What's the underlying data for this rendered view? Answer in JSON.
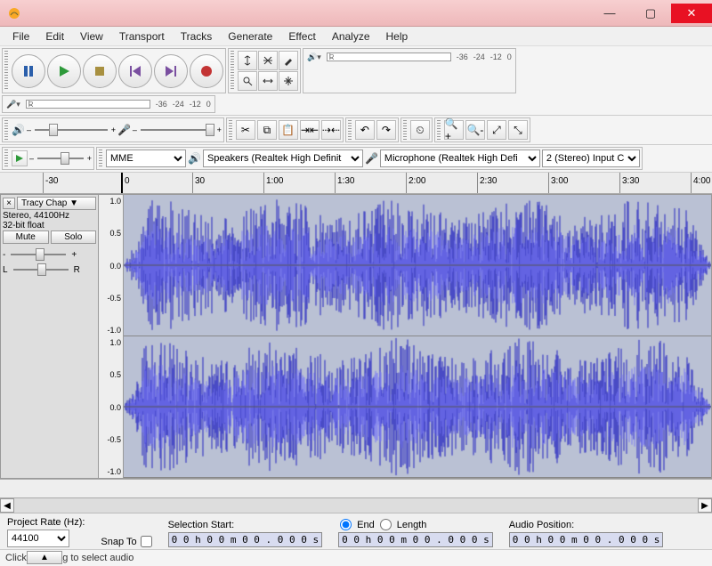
{
  "window": {
    "title": ""
  },
  "menu": [
    "File",
    "Edit",
    "View",
    "Transport",
    "Tracks",
    "Generate",
    "Effect",
    "Analyze",
    "Help"
  ],
  "meter_ticks": [
    "-36",
    "-24",
    "-12",
    "0"
  ],
  "host": {
    "selected": "MME"
  },
  "output": {
    "selected": "Speakers (Realtek High Definit"
  },
  "input": {
    "selected": "Microphone (Realtek High Defi"
  },
  "channels": {
    "selected": "2 (Stereo) Input C"
  },
  "timeline": {
    "ticks": [
      "-30",
      "0",
      "30",
      "1:00",
      "1:30",
      "2:00",
      "2:30",
      "3:00",
      "3:30",
      "4:00"
    ]
  },
  "track": {
    "name": "Tracy Chap",
    "format_line1": "Stereo, 44100Hz",
    "format_line2": "32-bit float",
    "mute": "Mute",
    "solo": "Solo",
    "gain_left": "-",
    "gain_right": "+",
    "pan_left": "L",
    "pan_right": "R",
    "vscale": [
      "1.0",
      "0.5",
      "0.0",
      "-0.5",
      "-1.0"
    ]
  },
  "bottom": {
    "project_rate_label": "Project Rate (Hz):",
    "project_rate": "44100",
    "snap_label": "Snap To",
    "sel_start_label": "Selection Start:",
    "end_label": "End",
    "length_label": "Length",
    "audio_pos_label": "Audio Position:",
    "timeval": "0 0 h 0 0 m 0 0 . 0 0 0 s"
  },
  "status": "Click and drag to select audio",
  "chart_data": {
    "type": "waveform",
    "channels": 2,
    "sample_rate_hz": 44100,
    "bit_depth": "32-bit float",
    "duration_seconds": 250,
    "y_range": [
      -1.0,
      1.0
    ],
    "envelope_note": "Dense stereo music waveform filling nearly full ±1.0 range from ~0s to ~4:00, amplitude builds from ~0.3 at start to near full-scale by ~0:20, sustained through track with slight fade at very end."
  }
}
